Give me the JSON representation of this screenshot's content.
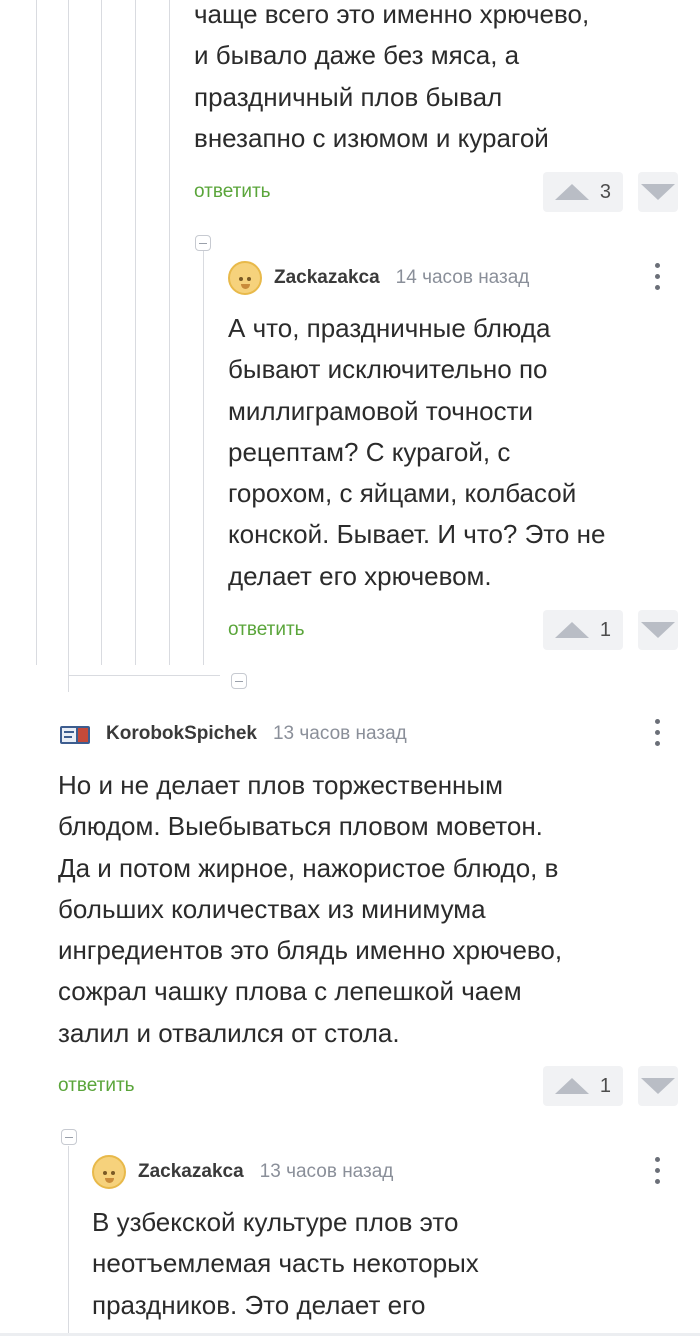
{
  "comments": [
    {
      "id": "c1",
      "text_lines": [
        "чаще всего это именно хрючево,",
        "и бывало даже без мяса, а",
        "праздничный плов бывал",
        "внезапно с изюмом и курагой"
      ],
      "reply_label": "ответить",
      "rating": "3"
    },
    {
      "id": "c2",
      "author": "Zackazakca",
      "time": "14 часов назад",
      "text_lines": [
        "А что, праздничные блюда",
        "бывают исключительно по",
        "миллиграмовой точности",
        "рецептам? С курагой, с",
        "горохом, с яйцами, колбасой",
        "конской. Бывает. И что? Это не",
        "делает его хрючевом."
      ],
      "reply_label": "ответить",
      "rating": "1"
    },
    {
      "id": "c3",
      "author": "KorobokSpichek",
      "time": "13 часов назад",
      "text_lines": [
        "Но и не делает плов торжественным",
        "блюдом. Выебываться пловом моветон.",
        "Да и потом жирное, нажористое блюдо, в",
        "больших количествах из минимума",
        "ингредиентов это блядь именно хрючево,",
        "сожрал чашку плова с лепешкой чаем",
        "залил и отвалился от стола."
      ],
      "reply_label": "ответить",
      "rating": "1"
    },
    {
      "id": "c4",
      "author": "Zackazakca",
      "time": "13 часов назад",
      "text_lines": [
        "В узбекской культуре плов это",
        "неотъемлемая часть некоторых",
        "праздников. Это делает его"
      ]
    }
  ],
  "icons": {
    "upvote": "arrow-up-icon",
    "downvote": "arrow-down-icon",
    "more": "more-vertical-icon",
    "collapse": "collapse-minus-icon"
  },
  "colors": {
    "reply_link": "#5aa53a",
    "thread_line": "#d9dbe0",
    "vote_bg": "#f1f2f4"
  }
}
